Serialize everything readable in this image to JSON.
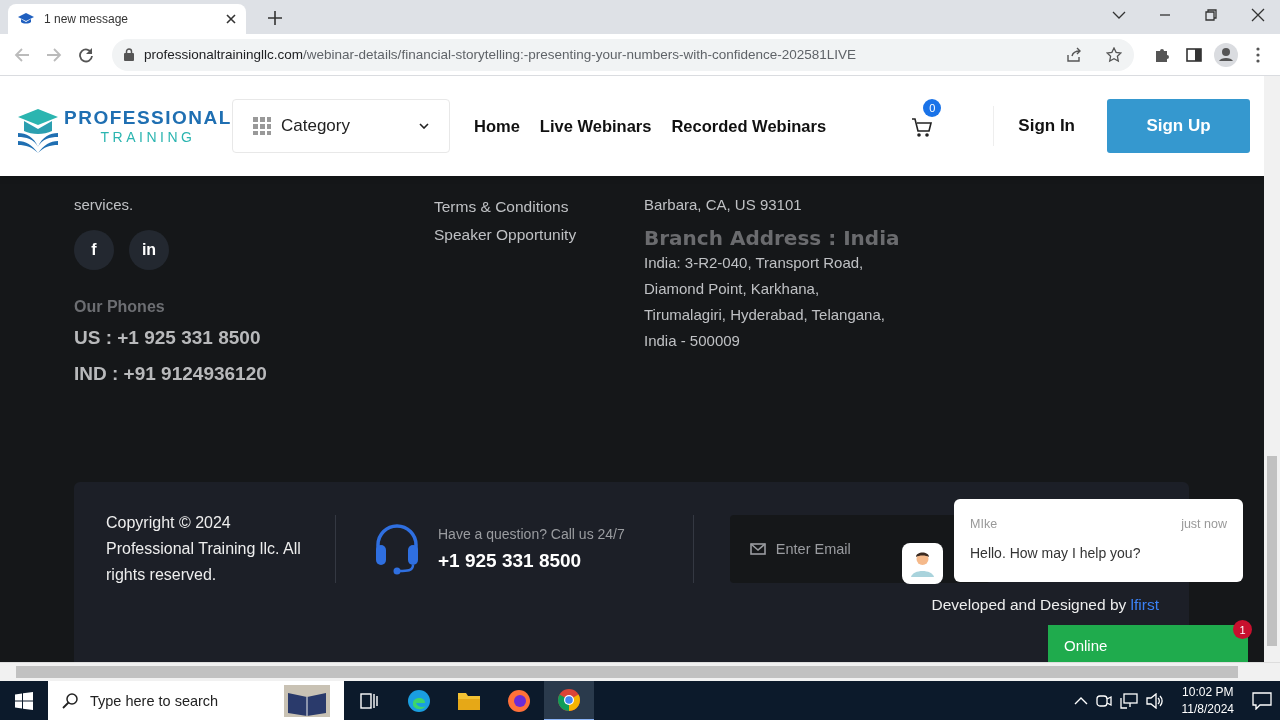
{
  "browser": {
    "tab_title": "1 new message",
    "url_domain": "professionaltrainingllc.com",
    "url_path": "/webinar-details/financial-storytelling:-presenting-your-numbers-with-confidence-202581LIVE"
  },
  "header": {
    "logo": {
      "line1": "PROFESSIONAL",
      "line2": "TRAINING"
    },
    "category": "Category",
    "nav": [
      "Home",
      "Live Webinars",
      "Recorded Webinars"
    ],
    "cart_count": "0",
    "sign_in": "Sign In",
    "sign_up": "Sign Up"
  },
  "footer": {
    "about_text": "services.",
    "social": [
      "f",
      "in"
    ],
    "phones_title": "Our Phones",
    "phones": [
      "US : +1 925 331 8500",
      "IND : +91 9124936120"
    ],
    "links": [
      "Terms & Conditions",
      "Speaker Opportunity"
    ],
    "address_tail": "Barbara, CA, US 93101",
    "branch_title": "Branch Address : India",
    "branch_lines": [
      "India: 3-R2-040, Transport Road,",
      "Diamond Point, Karkhana,",
      "Tirumalagiri, Hyderabad, Telangana,",
      "India - 500009"
    ]
  },
  "bottom": {
    "copyright": "Copyright © 2024 Professional Training llc. All rights reserved.",
    "question": "Have a question? Call us 24/7",
    "phone": "+1 925 331 8500",
    "email_placeholder": "Enter Email",
    "credit": "Developed and Designed by",
    "credit_link": "lfirst"
  },
  "chat": {
    "name": "MIke",
    "time": "just now",
    "message": "Hello. How may I help you?",
    "online_label": "Online",
    "unread": "1"
  },
  "taskbar": {
    "search_placeholder": "Type here to search",
    "time": "10:02 PM",
    "date": "11/8/2024"
  }
}
